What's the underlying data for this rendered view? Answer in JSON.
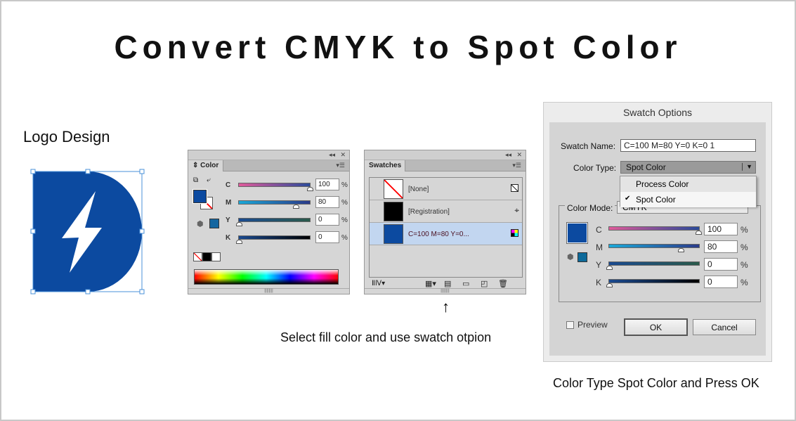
{
  "title": "Convert CMYK to Spot Color",
  "logo_caption": "Logo Design",
  "logo_color": "#0c4aa0",
  "color_panel": {
    "tab": "Color",
    "channels": [
      {
        "label": "C",
        "value": "100",
        "pct": "%"
      },
      {
        "label": "M",
        "value": "80",
        "pct": "%"
      },
      {
        "label": "Y",
        "value": "0",
        "pct": "%"
      },
      {
        "label": "K",
        "value": "0",
        "pct": "%"
      }
    ]
  },
  "swatches_panel": {
    "tab": "Swatches",
    "items": [
      {
        "name": "[None]",
        "icon": "none-icon"
      },
      {
        "name": "[Registration]",
        "icon": "registration-icon"
      },
      {
        "name": "C=100 M=80 Y=0...",
        "icon": "process-cmyk-icon"
      }
    ]
  },
  "middle_caption": "Select fill color and use swatch otpion",
  "dialog": {
    "title": "Swatch Options",
    "swatch_name_label": "Swatch Name:",
    "swatch_name_value": "C=100 M=80 Y=0 K=0 1",
    "color_type_label": "Color Type:",
    "color_type_value": "Spot Color",
    "options": [
      "Process Color",
      "Spot Color"
    ],
    "checked_option": "Spot Color",
    "color_mode_label": "Color Mode:",
    "color_mode_value": "CMYK",
    "channels": [
      {
        "label": "C",
        "value": "100",
        "pct": "%"
      },
      {
        "label": "M",
        "value": "80",
        "pct": "%"
      },
      {
        "label": "Y",
        "value": "0",
        "pct": "%"
      },
      {
        "label": "K",
        "value": "0",
        "pct": "%"
      }
    ],
    "preview_label": "Preview",
    "ok": "OK",
    "cancel": "Cancel"
  },
  "right_caption": "Color Type Spot Color and Press OK"
}
